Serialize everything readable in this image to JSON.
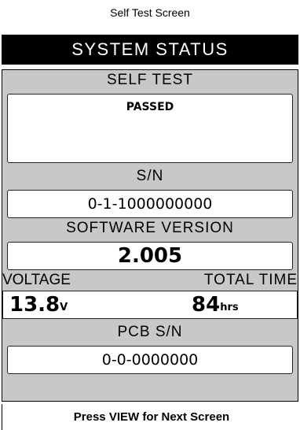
{
  "caption": "Self Test Screen",
  "title": "SYSTEM STATUS",
  "self_test": {
    "label": "SELF TEST",
    "value": "PASSED"
  },
  "serial": {
    "label": "S/N",
    "value": "0-1-1000000000"
  },
  "software": {
    "label": "SOFTWARE VERSION",
    "value": "2.005"
  },
  "voltage": {
    "label": "VOLTAGE",
    "value": "13.8",
    "unit": "V"
  },
  "total_time": {
    "label": "TOTAL TIME",
    "value": "84",
    "unit": "hrs"
  },
  "pcb": {
    "label": "PCB S/N",
    "value": "0-0-0000000"
  },
  "footer": "Press VIEW for Next Screen"
}
